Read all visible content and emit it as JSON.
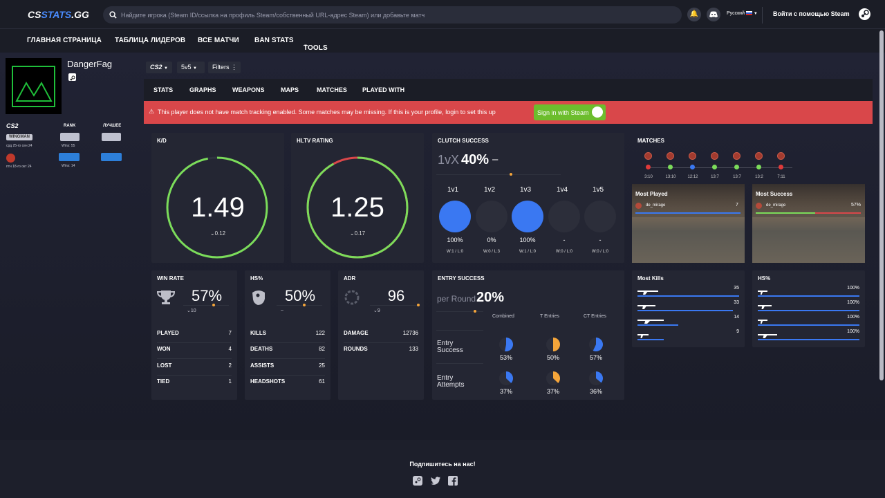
{
  "header": {
    "logo_a": "CS",
    "logo_b": "STATS",
    "logo_c": ".GG",
    "search_placeholder": "Найдите игрока (Steam ID/ссылка на профиль Steam/собственный URL-адрес Steam) или добавьте матч",
    "language": "Русский",
    "login": "Войти с помощью Steam"
  },
  "nav": [
    "ГЛАВНАЯ СТРАНИЦА",
    "ТАБЛИЦА ЛИДЕРОВ",
    "ВСЕ МАТЧИ",
    "BAN STATS",
    "TOOLS"
  ],
  "profile": {
    "name": "DangerFag",
    "game": "CS2",
    "rank_header": "RANK",
    "best_header": "ЛУЧШЕЕ",
    "row1_mode": "WINGMAN",
    "row1_date": "срд 25-го сен 24",
    "row1_wins": "Wins: 55",
    "row2_date": "птн 18-го окт 24",
    "row2_wins": "Wins: 14"
  },
  "filters": {
    "game": "CS2",
    "mode": "5v5",
    "label": "Filters"
  },
  "tabs": [
    "STATS",
    "GRAPHS",
    "WEAPONS",
    "MAPS",
    "MATCHES",
    "PLAYED WITH"
  ],
  "alert": {
    "text": "This player does not have match tracking enabled. Some matches may be missing. If this is your profile, login to set this up",
    "button": "Sign in with Steam"
  },
  "kd": {
    "title": "K/D",
    "value": "1.49",
    "delta": "0.12",
    "ring_fraction": 0.97
  },
  "hltv": {
    "title": "HLTV RATING",
    "value": "1.25",
    "delta": "0.17",
    "ring_fraction": 0.92
  },
  "clutch": {
    "title": "CLUTCH SUCCESS",
    "prefix": "1vX",
    "percent": "40%",
    "suffix": "–",
    "items": [
      {
        "label": "1v1",
        "pct": "100%",
        "wl": "W:1 / L:0",
        "active": true
      },
      {
        "label": "1v2",
        "pct": "0%",
        "wl": "W:0 / L:3",
        "active": false
      },
      {
        "label": "1v3",
        "pct": "100%",
        "wl": "W:1 / L:0",
        "active": true
      },
      {
        "label": "1v4",
        "pct": "-",
        "wl": "W:0 / L:0",
        "active": false
      },
      {
        "label": "1v5",
        "pct": "-",
        "wl": "W:0 / L:0",
        "active": false
      }
    ]
  },
  "matches": {
    "title": "MATCHES",
    "items": [
      {
        "score": "3:10",
        "color": "#e03a3a"
      },
      {
        "score": "13:10",
        "color": "#7bdc5a"
      },
      {
        "score": "12:12",
        "color": "#3a78f2"
      },
      {
        "score": "13:7",
        "color": "#7bdc5a"
      },
      {
        "score": "13:7",
        "color": "#7bdc5a"
      },
      {
        "score": "13:2",
        "color": "#7bdc5a"
      },
      {
        "score": "7:11",
        "color": "#e03a3a"
      }
    ],
    "most_played": {
      "title": "Most Played",
      "map": "de_mirage",
      "value": "7"
    },
    "most_success": {
      "title": "Most Success",
      "map": "de_mirage",
      "value": "57%"
    }
  },
  "winrate": {
    "title": "WIN RATE",
    "value": "57%",
    "delta": "10",
    "rows": [
      [
        "PLAYED",
        "7"
      ],
      [
        "WON",
        "4"
      ],
      [
        "LOST",
        "2"
      ],
      [
        "TIED",
        "1"
      ]
    ]
  },
  "hs": {
    "title": "HS%",
    "value": "50%",
    "delta": "–",
    "rows": [
      [
        "KILLS",
        "122"
      ],
      [
        "DEATHS",
        "82"
      ],
      [
        "ASSISTS",
        "25"
      ],
      [
        "HEADSHOTS",
        "61"
      ]
    ]
  },
  "adr": {
    "title": "ADR",
    "value": "96",
    "delta": "9",
    "rows": [
      [
        "DAMAGE",
        "12736"
      ],
      [
        "ROUNDS",
        "133"
      ]
    ]
  },
  "entry": {
    "title": "ENTRY SUCCESS",
    "prefix": "per Round",
    "percent": "20%",
    "cols": [
      "Combined",
      "T Entries",
      "CT Entries"
    ],
    "rows": [
      {
        "label1": "Entry",
        "label2": "Success",
        "values": [
          "53%",
          "50%",
          "57%"
        ],
        "fracs": [
          0.53,
          0.5,
          0.57
        ]
      },
      {
        "label1": "Entry",
        "label2": "Attempts",
        "values": [
          "37%",
          "37%",
          "36%"
        ],
        "fracs": [
          0.37,
          0.37,
          0.36
        ]
      }
    ]
  },
  "most_kills": {
    "title": "Most Kills",
    "values": [
      "35",
      "33",
      "14",
      "9"
    ],
    "fracs": [
      1.0,
      0.94,
      0.4,
      0.26
    ]
  },
  "weapon_hs": {
    "title": "HS%",
    "values": [
      "100%",
      "100%",
      "100%",
      "100%"
    ],
    "fracs": [
      1.0,
      1.0,
      1.0,
      1.0
    ]
  },
  "footer": {
    "text": "Подпишитесь на нас!"
  },
  "colors": {
    "accent": "#4a8cff",
    "green": "#7bdc5a",
    "red": "#d9474a",
    "blue": "#3a78f2",
    "orange": "#f5a53a"
  }
}
